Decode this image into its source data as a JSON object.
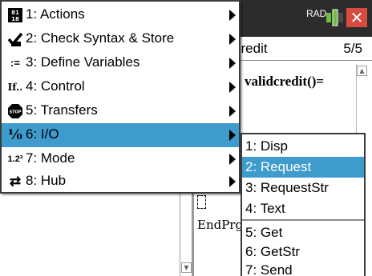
{
  "status": {
    "angle_mode": "RAD"
  },
  "document": {
    "name": "credit",
    "page_count": "5/5"
  },
  "editor": {
    "function_line": "validcredit()=",
    "end_line": "EndPrg"
  },
  "colors": {
    "highlight": "#3e9bcc",
    "close": "#d84b3f",
    "topbar": "#2c2c2c"
  },
  "menu": {
    "items": [
      {
        "label": "1: Actions",
        "icon": "actions-icon",
        "has_submenu": true
      },
      {
        "label": "2: Check Syntax & Store",
        "icon": "check-syntax-icon",
        "has_submenu": true
      },
      {
        "label": "3: Define Variables",
        "icon": "define-variables-icon",
        "has_submenu": true
      },
      {
        "label": "4: Control",
        "icon": "control-icon",
        "has_submenu": true
      },
      {
        "label": "5: Transfers",
        "icon": "transfers-icon",
        "has_submenu": true
      },
      {
        "label": "6: I/O",
        "icon": "io-icon",
        "has_submenu": true,
        "selected": true
      },
      {
        "label": "7: Mode",
        "icon": "mode-icon",
        "has_submenu": true
      },
      {
        "label": "8: Hub",
        "icon": "hub-icon",
        "has_submenu": true
      }
    ]
  },
  "submenu": {
    "items": [
      {
        "label": "1: Disp"
      },
      {
        "label": "2: Request",
        "selected": true
      },
      {
        "label": "3: RequestStr"
      },
      {
        "label": "4: Text"
      },
      {
        "label": "5: Get"
      },
      {
        "label": "6: GetStr"
      },
      {
        "label": "7: Send"
      }
    ]
  }
}
